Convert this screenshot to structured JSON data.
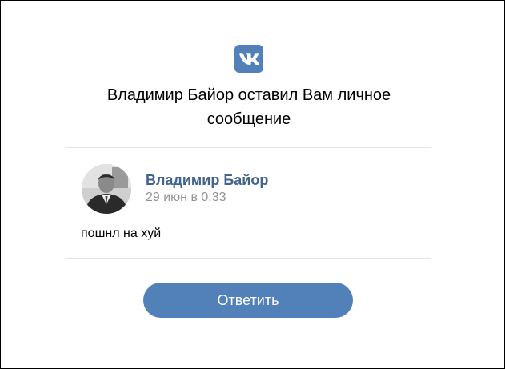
{
  "brand": {
    "logo_icon": "vk-logo-icon",
    "accent_color": "#5181b8"
  },
  "headline": "Владимир Байор оставил Вам личное сообщение",
  "message_card": {
    "author_name": "Владимир Байор",
    "timestamp": "29 июн в 0:33",
    "text": "пошнл на хуй",
    "avatar_icon": "user-avatar",
    "name_color": "#42648b"
  },
  "reply_button": {
    "label": "Ответить"
  }
}
